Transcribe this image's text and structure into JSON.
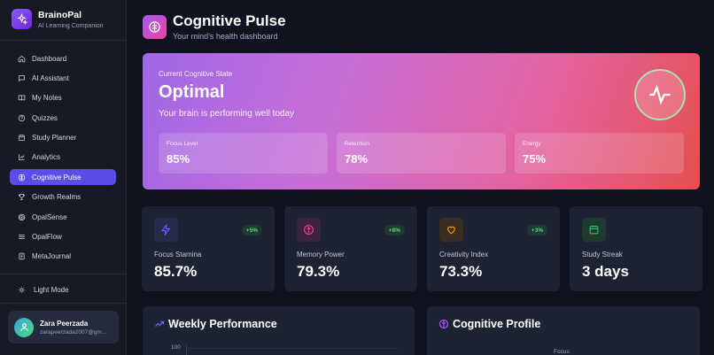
{
  "brand": {
    "name": "BrainoPal",
    "tagline": "AI Learning Companion"
  },
  "nav": {
    "items": [
      {
        "label": "Dashboard",
        "icon": "home-icon"
      },
      {
        "label": "AI Assistant",
        "icon": "chat-icon"
      },
      {
        "label": "My Notes",
        "icon": "book-icon"
      },
      {
        "label": "Quizzes",
        "icon": "quiz-icon"
      },
      {
        "label": "Study Planner",
        "icon": "calendar-icon"
      },
      {
        "label": "Analytics",
        "icon": "chart-icon"
      },
      {
        "label": "Cognitive Pulse",
        "icon": "brain-icon",
        "active": true
      },
      {
        "label": "Growth Realms",
        "icon": "trophy-icon"
      },
      {
        "label": "OpalSense",
        "icon": "target-icon"
      },
      {
        "label": "OpalFlow",
        "icon": "waves-icon"
      },
      {
        "label": "MetaJournal",
        "icon": "journal-icon"
      }
    ],
    "light_mode": "Light Mode"
  },
  "user": {
    "name": "Zara Peerzada",
    "email": "zarapeerzada2007@gm..."
  },
  "header": {
    "title": "Cognitive Pulse",
    "subtitle": "Your mind's health dashboard"
  },
  "hero": {
    "label": "Current Cognitive State",
    "state": "Optimal",
    "description": "Your brain is performing well today",
    "metrics": [
      {
        "label": "Focus Level",
        "value": "85%"
      },
      {
        "label": "Retention",
        "value": "78%"
      },
      {
        "label": "Energy",
        "value": "75%"
      }
    ]
  },
  "stats": [
    {
      "label": "Focus Stamina",
      "value": "85.7%",
      "change": "+5%",
      "icon": "lightning-icon",
      "color": "#6366f1"
    },
    {
      "label": "Memory Power",
      "value": "79.3%",
      "change": "+8%",
      "icon": "brain-icon",
      "color": "#ec4899"
    },
    {
      "label": "Creativity Index",
      "value": "73.3%",
      "change": "+3%",
      "icon": "heart-icon",
      "color": "#f59e0b"
    },
    {
      "label": "Study Streak",
      "value": "3 days",
      "change": "",
      "icon": "calendar-icon",
      "color": "#22c55e"
    }
  ],
  "panels": {
    "weekly": {
      "title": "Weekly Performance",
      "y_tick": "100"
    },
    "profile": {
      "title": "Cognitive Profile",
      "axis_label": "Focus"
    }
  },
  "colors": {
    "accent": "#5b4ee8",
    "positive": "#4ade80"
  }
}
